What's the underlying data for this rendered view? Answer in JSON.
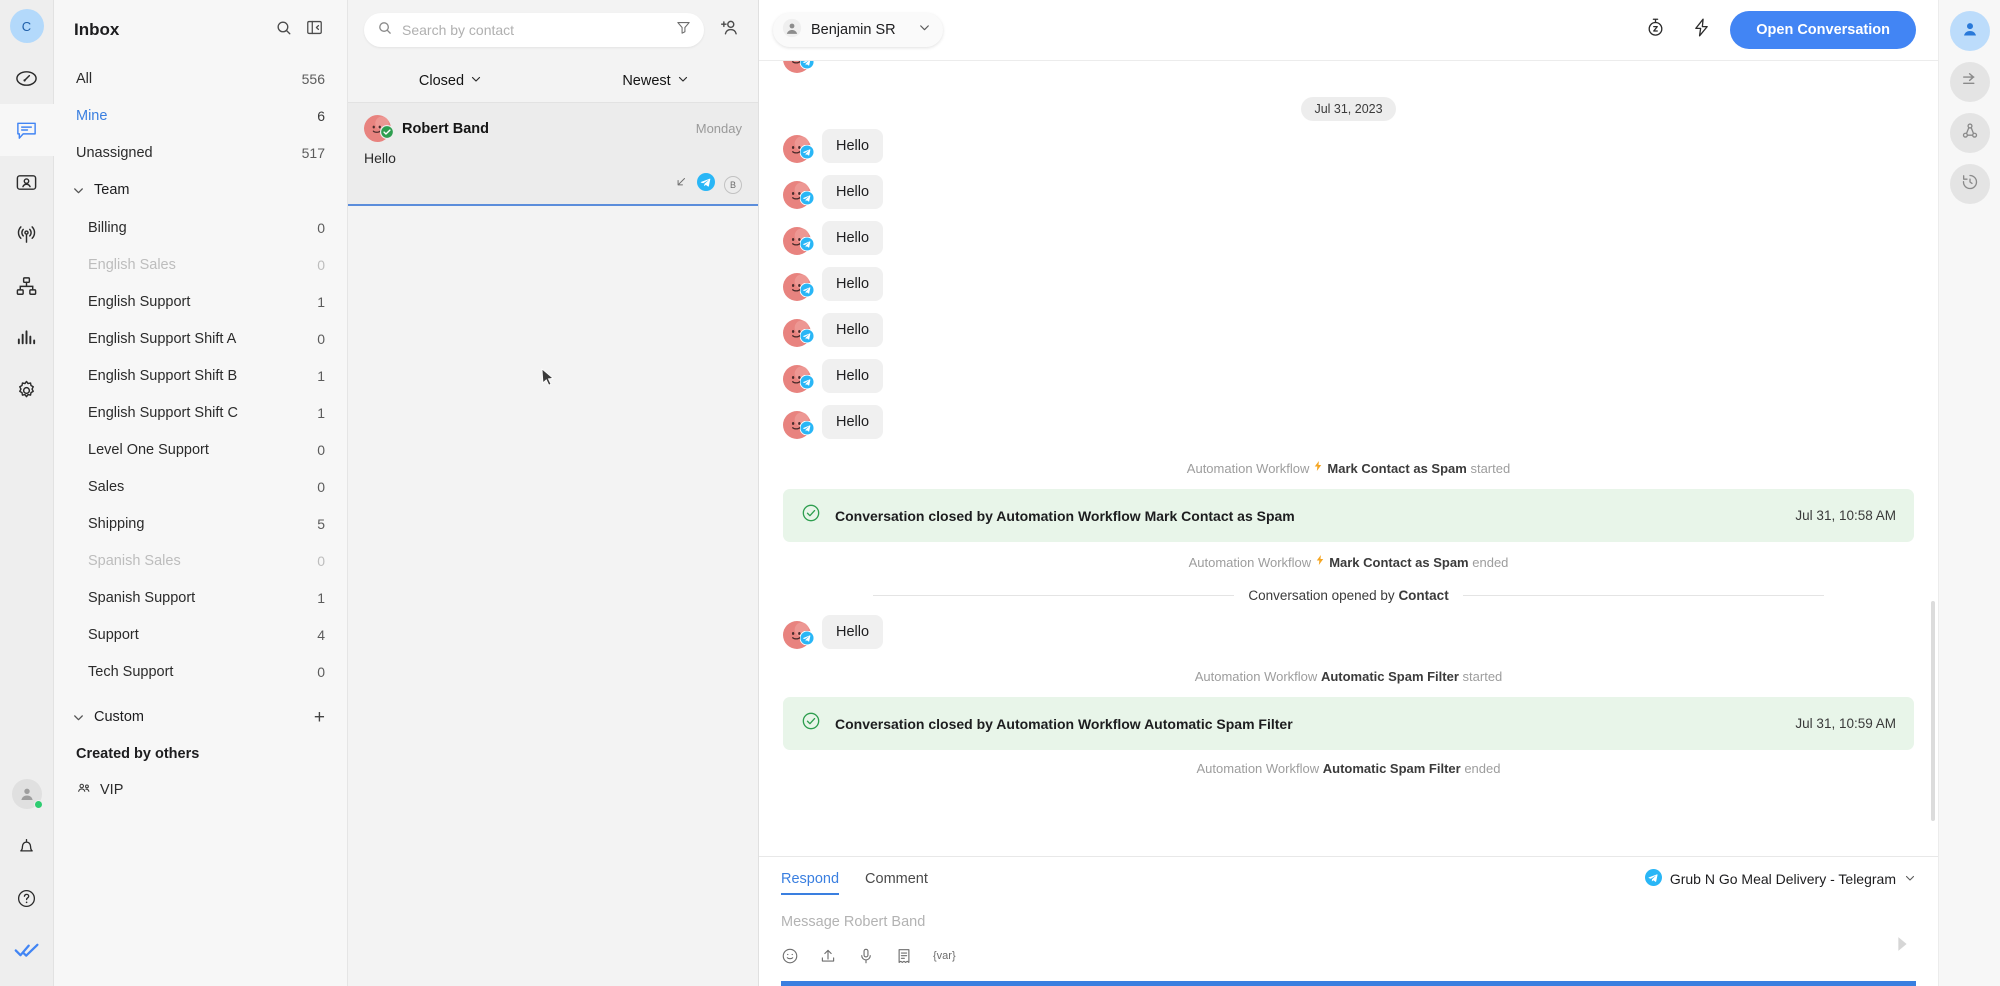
{
  "brand": {
    "accent": "#4285f4",
    "success": "#2e9e4f",
    "banner_bg": "#e8f5e9",
    "telegram": "#29b6f6"
  },
  "rail": {
    "avatar_initial": "C",
    "items": [
      {
        "name": "dashboard-icon",
        "label": "Dashboard"
      },
      {
        "name": "messages-icon",
        "label": "Messages"
      },
      {
        "name": "contacts-icon",
        "label": "Contacts"
      },
      {
        "name": "broadcast-icon",
        "label": "Broadcast"
      },
      {
        "name": "workflows-icon",
        "label": "Workflows"
      },
      {
        "name": "reports-icon",
        "label": "Reports"
      },
      {
        "name": "settings-icon",
        "label": "Settings"
      }
    ],
    "bottom": [
      {
        "name": "user-avatar-icon",
        "label": "Account"
      },
      {
        "name": "bell-icon",
        "label": "Notifications"
      },
      {
        "name": "help-icon",
        "label": "Help"
      },
      {
        "name": "logo-icon",
        "label": "Respond.io"
      }
    ]
  },
  "sidebar": {
    "title": "Inbox",
    "search_icon": "search-icon",
    "collapse_icon": "collapse-panel-icon",
    "quick": [
      {
        "label": "All",
        "count": "556",
        "state": "normal"
      },
      {
        "label": "Mine",
        "count": "6",
        "state": "selected"
      },
      {
        "label": "Unassigned",
        "count": "517",
        "state": "normal"
      }
    ],
    "team_group": {
      "label": "Team",
      "expanded": true
    },
    "teams": [
      {
        "label": "Billing",
        "count": "0",
        "state": "normal"
      },
      {
        "label": "English Sales",
        "count": "0",
        "state": "muted"
      },
      {
        "label": "English Support",
        "count": "1",
        "state": "normal"
      },
      {
        "label": "English Support Shift A",
        "count": "0",
        "state": "normal"
      },
      {
        "label": "English Support Shift B",
        "count": "1",
        "state": "normal"
      },
      {
        "label": "English Support Shift C",
        "count": "1",
        "state": "normal"
      },
      {
        "label": "Level One Support",
        "count": "0",
        "state": "normal"
      },
      {
        "label": "Sales",
        "count": "0",
        "state": "normal"
      },
      {
        "label": "Shipping",
        "count": "5",
        "state": "normal"
      },
      {
        "label": "Spanish Sales",
        "count": "0",
        "state": "muted"
      },
      {
        "label": "Spanish Support",
        "count": "1",
        "state": "normal"
      },
      {
        "label": "Support",
        "count": "4",
        "state": "normal"
      },
      {
        "label": "Tech Support",
        "count": "0",
        "state": "normal"
      }
    ],
    "custom_group": {
      "label": "Custom",
      "add_label": "+"
    },
    "custom_subheader": "Created by others",
    "custom_items": [
      {
        "label": "VIP",
        "icon": "people-icon"
      }
    ]
  },
  "conversation_list": {
    "search": {
      "placeholder": "Search by contact",
      "value": ""
    },
    "filter_icon": "funnel-filter-icon",
    "add_contact_icon": "add-contact-icon",
    "status_filter": "Closed",
    "sort_filter": "Newest",
    "items": [
      {
        "name": "Robert Band",
        "time": "Monday",
        "preview": "Hello",
        "channel": "telegram",
        "assignee_initial": "B",
        "direction_icon": "incoming-arrow-icon",
        "status": "closed",
        "selected": true
      }
    ]
  },
  "conversation": {
    "assignee": "Benjamin SR",
    "assignee_icon": "person-icon",
    "chevron_icon": "chevron-down-icon",
    "snooze_icon": "snooze-icon",
    "shortcuts_icon": "lightning-icon",
    "open_button": "Open Conversation",
    "date_separator": "Jul 31, 2023",
    "thread": [
      {
        "type": "message",
        "text": "Hello",
        "channel": "telegram"
      },
      {
        "type": "message",
        "text": "Hello",
        "channel": "telegram"
      },
      {
        "type": "message",
        "text": "Hello",
        "channel": "telegram"
      },
      {
        "type": "message",
        "text": "Hello",
        "channel": "telegram"
      },
      {
        "type": "message",
        "text": "Hello",
        "channel": "telegram"
      },
      {
        "type": "message",
        "text": "Hello",
        "channel": "telegram"
      },
      {
        "type": "message",
        "text": "Hello",
        "channel": "telegram"
      },
      {
        "type": "workflow",
        "prefix": "Automation Workflow",
        "name": "Mark Contact as Spam",
        "suffix": "started"
      },
      {
        "type": "closed",
        "text": "Conversation closed by Automation Workflow Mark Contact as Spam",
        "time": "Jul 31, 10:58 AM"
      },
      {
        "type": "workflow",
        "prefix": "Automation Workflow",
        "name": "Mark Contact as Spam",
        "suffix": "ended"
      },
      {
        "type": "divider",
        "text": "Conversation opened by ",
        "bold": "Contact"
      },
      {
        "type": "message",
        "text": "Hello",
        "channel": "telegram"
      },
      {
        "type": "workflow_plain",
        "prefix": "Automation Workflow",
        "name": "Automatic Spam Filter",
        "suffix": "started"
      },
      {
        "type": "closed",
        "text": "Conversation closed by Automation Workflow Automatic Spam Filter",
        "time": "Jul 31, 10:59 AM"
      },
      {
        "type": "workflow_plain",
        "prefix": "Automation Workflow",
        "name": "Automatic Spam Filter",
        "suffix": "ended"
      }
    ]
  },
  "composer": {
    "tabs": [
      {
        "label": "Respond",
        "active": true
      },
      {
        "label": "Comment",
        "active": false
      }
    ],
    "channel": "Grub N Go Meal Delivery - Telegram",
    "channel_icon": "telegram-icon",
    "placeholder": "Message Robert Band",
    "value": "",
    "tools": [
      {
        "name": "emoji-icon",
        "label": "Emoji"
      },
      {
        "name": "attach-upload-icon",
        "label": "Upload file"
      },
      {
        "name": "microphone-icon",
        "label": "Voice note"
      },
      {
        "name": "snippet-icon",
        "label": "Snippets"
      },
      {
        "name": "variable-icon",
        "label": "{var}"
      }
    ],
    "send_icon": "send-icon"
  },
  "right_rail": [
    {
      "name": "contact-details-icon",
      "label": "Contact",
      "active": true
    },
    {
      "name": "forward-transfer-icon",
      "label": "Transfer",
      "active": false
    },
    {
      "name": "integrations-icon",
      "label": "Integrations",
      "active": false
    },
    {
      "name": "history-icon",
      "label": "History",
      "active": false
    }
  ]
}
